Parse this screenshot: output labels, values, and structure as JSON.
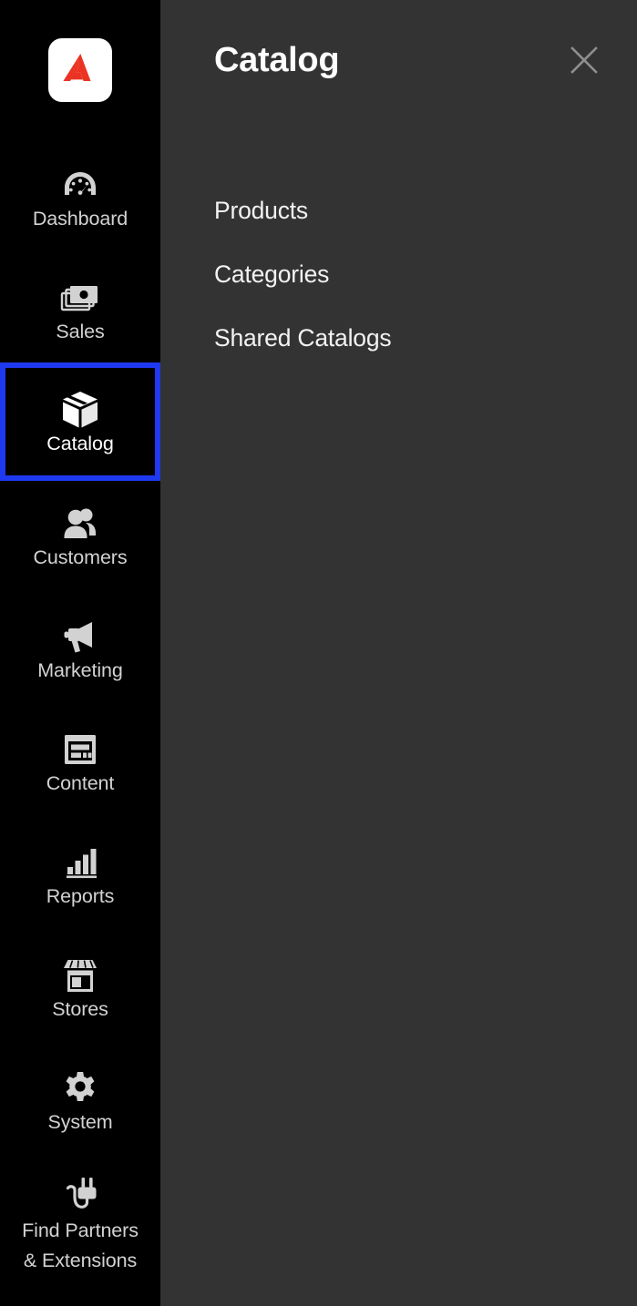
{
  "app": {
    "logo_name": "adobe-commerce-logo",
    "logo_color": "#eb3323",
    "sidebar_bg": "#000000",
    "panel_bg": "#333333",
    "focus_ring_color": "#1f39f0",
    "label_color": "#d2d2d2"
  },
  "sidebar": {
    "items": [
      {
        "label": "Dashboard",
        "icon": "gauge-icon",
        "selected": false
      },
      {
        "label": "Sales",
        "icon": "money-stack-icon",
        "selected": false
      },
      {
        "label": "Catalog",
        "icon": "box-icon",
        "selected": true
      },
      {
        "label": "Customers",
        "icon": "users-icon",
        "selected": false
      },
      {
        "label": "Marketing",
        "icon": "megaphone-icon",
        "selected": false
      },
      {
        "label": "Content",
        "icon": "page-layout-icon",
        "selected": false
      },
      {
        "label": "Reports",
        "icon": "bar-chart-icon",
        "selected": false
      },
      {
        "label": "Stores",
        "icon": "storefront-icon",
        "selected": false
      },
      {
        "label": "System",
        "icon": "gear-icon",
        "selected": false
      },
      {
        "label": "Find Partners\n& Extensions",
        "label_line1": "Find Partners",
        "label_line2": "& Extensions",
        "icon": "plug-icon",
        "selected": false
      }
    ]
  },
  "panel": {
    "title": "Catalog",
    "close_icon": "close-icon",
    "items": [
      {
        "label": "Products"
      },
      {
        "label": "Categories"
      },
      {
        "label": "Shared Catalogs"
      }
    ]
  }
}
